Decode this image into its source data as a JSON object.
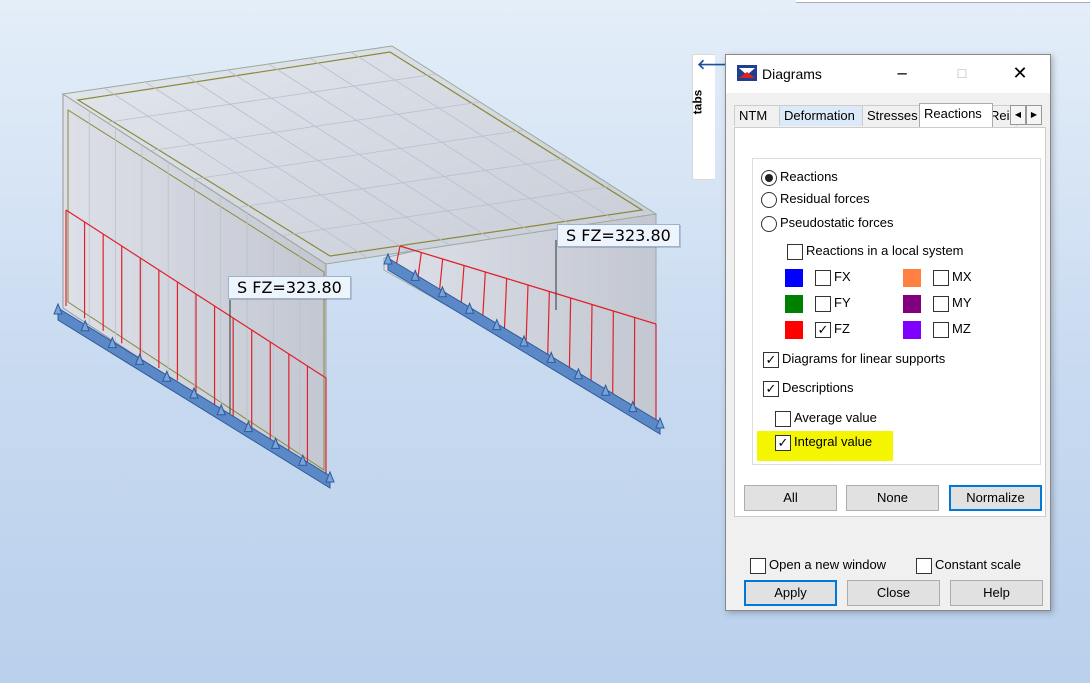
{
  "viewport": {
    "labels": [
      "S  FZ=323.80",
      "S  FZ=323.80"
    ]
  },
  "side_tab": {
    "label": "tabs",
    "arrow": "arrow-left-icon"
  },
  "dialog": {
    "title": "Diagrams",
    "window_controls": {
      "minimize": "─",
      "maximize": "☐",
      "close": "✕"
    },
    "tabs": [
      "NTM",
      "Deformation",
      "Stresses",
      "Reactions",
      "Rei"
    ],
    "active_tab": "Reactions",
    "reactions_panel": {
      "radios": [
        {
          "label": "Reactions",
          "selected": true
        },
        {
          "label": "Residual forces",
          "selected": false
        },
        {
          "label": "Pseudostatic forces",
          "selected": false
        }
      ],
      "local_system": {
        "label": "Reactions in a local system",
        "checked": false
      },
      "components": [
        {
          "label": "FX",
          "checked": false,
          "color": "#0000ff"
        },
        {
          "label": "FY",
          "checked": false,
          "color": "#008000"
        },
        {
          "label": "FZ",
          "checked": true,
          "color": "#ff0000"
        },
        {
          "label": "MX",
          "checked": false,
          "color": "#ff8040"
        },
        {
          "label": "MY",
          "checked": false,
          "color": "#800080"
        },
        {
          "label": "MZ",
          "checked": false,
          "color": "#8000ff"
        }
      ],
      "linear_supports": {
        "label": "Diagrams for linear supports",
        "checked": true
      },
      "descriptions": {
        "label": "Descriptions",
        "checked": true
      },
      "average_value": {
        "label": "Average value",
        "checked": false
      },
      "integral_value": {
        "label": "Integral value",
        "checked": true
      },
      "highlight_color": "#f4f500"
    },
    "panel_buttons": {
      "all": "All",
      "none": "None",
      "normalize": "Normalize"
    },
    "footer": {
      "open_new_window": {
        "label": "Open a new window",
        "checked": false
      },
      "constant_scale": {
        "label": "Constant scale",
        "checked": false
      },
      "apply": "Apply",
      "close": "Close",
      "help": "Help"
    }
  }
}
